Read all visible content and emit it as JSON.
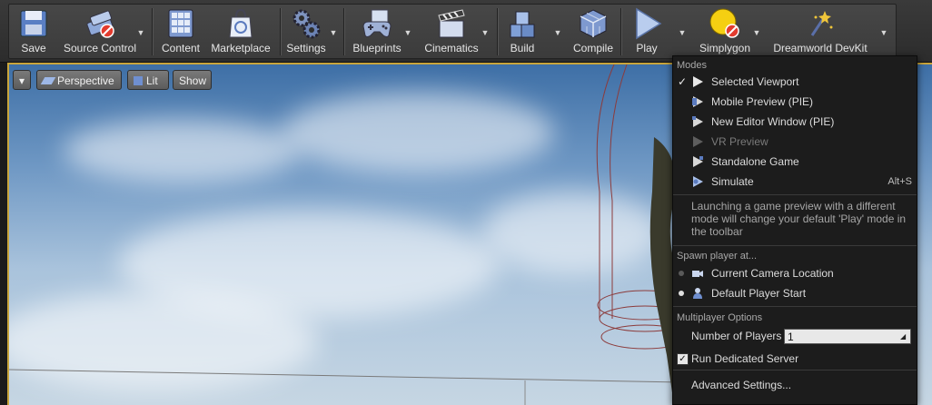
{
  "toolbar": {
    "buttons": [
      {
        "label": "Save",
        "icon": "floppy-disk-icon"
      },
      {
        "label": "Source Control",
        "icon": "source-control-icon"
      },
      {
        "label": "Content",
        "icon": "content-browser-icon"
      },
      {
        "label": "Marketplace",
        "icon": "marketplace-bag-icon"
      },
      {
        "label": "Settings",
        "icon": "settings-gears-icon"
      },
      {
        "label": "Blueprints",
        "icon": "blueprints-gamepad-icon"
      },
      {
        "label": "Cinematics",
        "icon": "clapperboard-icon"
      },
      {
        "label": "Build",
        "icon": "build-blocks-icon"
      },
      {
        "label": "Compile",
        "icon": "compile-cube-icon"
      },
      {
        "label": "Play",
        "icon": "play-triangle-icon"
      },
      {
        "label": "Simplygon",
        "icon": "simplygon-icon"
      },
      {
        "label": "Dreamworld DevKit",
        "icon": "magic-wand-icon"
      }
    ]
  },
  "viewport": {
    "perspective": "Perspective",
    "lit": "Lit",
    "show": "Show"
  },
  "menu": {
    "modes_header": "Modes",
    "modes": [
      {
        "label": "Selected Viewport",
        "checked": true,
        "disabled": false,
        "shortcut": ""
      },
      {
        "label": "Mobile Preview (PIE)",
        "checked": false,
        "disabled": false,
        "shortcut": ""
      },
      {
        "label": "New Editor Window (PIE)",
        "checked": false,
        "disabled": false,
        "shortcut": ""
      },
      {
        "label": "VR Preview",
        "checked": false,
        "disabled": true,
        "shortcut": ""
      },
      {
        "label": "Standalone Game",
        "checked": false,
        "disabled": false,
        "shortcut": ""
      },
      {
        "label": "Simulate",
        "checked": false,
        "disabled": false,
        "shortcut": "Alt+S"
      }
    ],
    "description": "Launching a game preview with a different mode will change your default 'Play' mode in the toolbar",
    "spawn_header": "Spawn player at...",
    "spawn": [
      {
        "label": "Current Camera Location",
        "selected": false
      },
      {
        "label": "Default Player Start",
        "selected": true
      }
    ],
    "multiplayer_header": "Multiplayer Options",
    "number_of_players_label": "Number of Players",
    "number_of_players_value": "1",
    "dedicated_server_label": "Run Dedicated Server",
    "dedicated_server_checked": true,
    "advanced_label": "Advanced Settings..."
  },
  "colors": {
    "viewport_border": "#c9a53b",
    "menu_bg": "#1c1c1c"
  }
}
